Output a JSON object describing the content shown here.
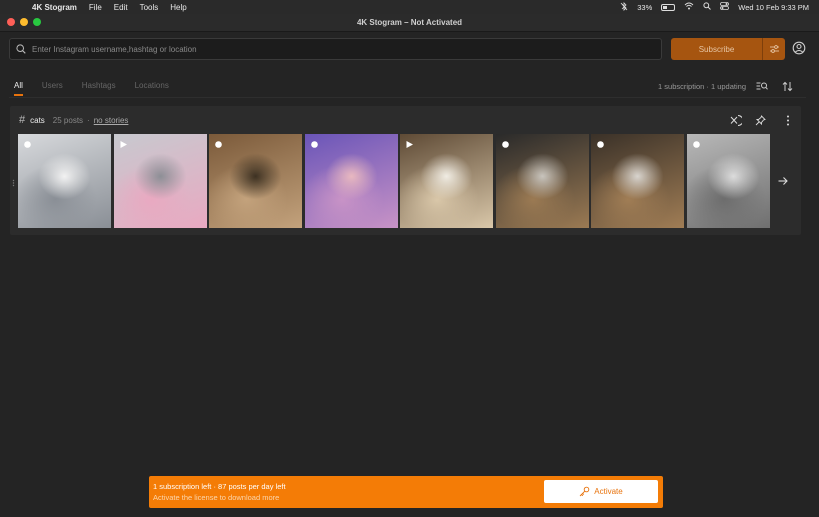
{
  "menubar": {
    "app_name": "4K Stogram",
    "menus": [
      "File",
      "Edit",
      "Tools",
      "Help"
    ],
    "battery": "33%",
    "clock": "Wed 10 Feb  9:33 PM"
  },
  "window": {
    "title": "4K Stogram – Not Activated"
  },
  "search": {
    "placeholder": "Enter Instagram username,hashtag or location"
  },
  "toolbar": {
    "subscribe_label": "Subscribe"
  },
  "tabs": [
    {
      "label": "All",
      "active": true
    },
    {
      "label": "Users",
      "active": false
    },
    {
      "label": "Hashtags",
      "active": false
    },
    {
      "label": "Locations",
      "active": false
    }
  ],
  "status": {
    "text": "1 subscription  ·  1 updating"
  },
  "subscription": {
    "tag": "cats",
    "posts": "25 posts",
    "separator": "·",
    "stories": "no stories"
  },
  "thumbnails": [
    {
      "kind": "photo",
      "colors": [
        "#d7d9dc",
        "#8a8f96",
        "#f2f2f2"
      ]
    },
    {
      "kind": "video",
      "colors": [
        "#c7c9cf",
        "#e9a9c1",
        "#8d8f96"
      ]
    },
    {
      "kind": "photo",
      "colors": [
        "#7b5a3a",
        "#c3a27c",
        "#3d3122"
      ]
    },
    {
      "kind": "photo",
      "colors": [
        "#6a55b8",
        "#c893c6",
        "#e8b8c0"
      ]
    },
    {
      "kind": "video",
      "colors": [
        "#5e4a35",
        "#d9c7a9",
        "#f0ece3"
      ]
    },
    {
      "kind": "photo",
      "colors": [
        "#2a2a2a",
        "#9b7a53",
        "#c8c4bd"
      ]
    },
    {
      "kind": "photo",
      "colors": [
        "#3a3128",
        "#a07d55",
        "#d8d4ce"
      ]
    },
    {
      "kind": "photo",
      "colors": [
        "#b8b8b8",
        "#6d6d6d",
        "#dcdcdc"
      ]
    }
  ],
  "banner": {
    "line1": "1 subscription left  ·  87 posts per day left",
    "line2": "Activate the license to download more",
    "activate_label": "Activate"
  },
  "colors": {
    "accent": "#f47c06",
    "subscribe_bg": "#a65510",
    "background": "#242424",
    "card": "#2c2c2c"
  }
}
